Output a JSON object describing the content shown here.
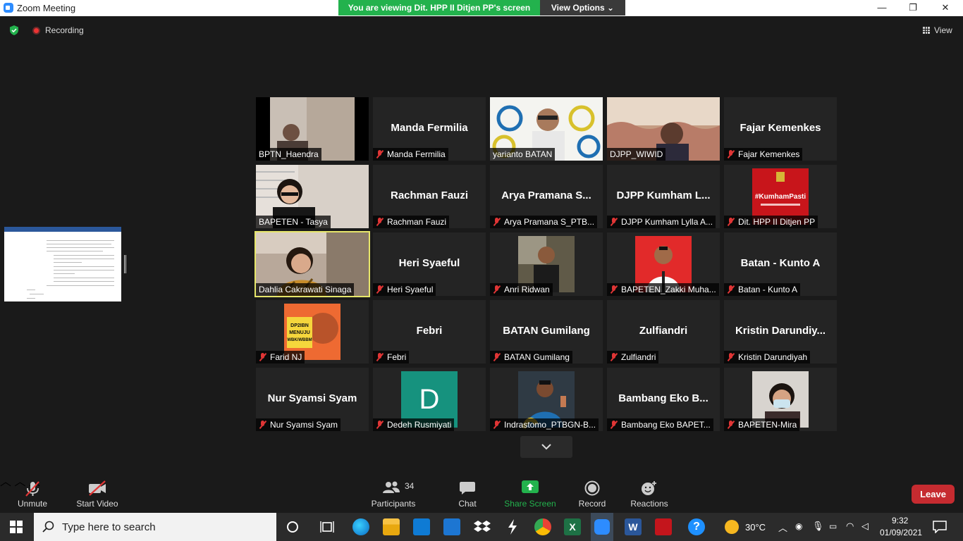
{
  "titlebar": {
    "title": "Zoom Meeting",
    "share_banner": "You are viewing Dit. HPP II Ditjen PP's screen",
    "view_options": "View Options",
    "minimize": "—",
    "maximize": "❐",
    "close": "✕"
  },
  "status": {
    "recording": "Recording",
    "view": "View"
  },
  "participants_grid": [
    {
      "name": "BPTN_Haendra",
      "big": "",
      "muted": false,
      "video": "office"
    },
    {
      "name": "Manda Fermilia",
      "big": "Manda Fermilia",
      "muted": true,
      "video": ""
    },
    {
      "name": "yarianto BATAN",
      "big": "",
      "muted": false,
      "video": "batan"
    },
    {
      "name": "DJPP_WIWID",
      "big": "",
      "muted": false,
      "video": "curtain"
    },
    {
      "name": "Fajar Kemenkes",
      "big": "Fajar Kemenkes",
      "muted": true,
      "video": ""
    },
    {
      "name": "BAPETEN - Tasya",
      "big": "",
      "muted": false,
      "video": "woman"
    },
    {
      "name": "Rachman Fauzi",
      "big": "Rachman Fauzi",
      "muted": true,
      "video": ""
    },
    {
      "name": "Arya Pramana S_PTB...",
      "big": "Arya Pramana S...",
      "muted": true,
      "video": ""
    },
    {
      "name": "DJPP Kumham Lylla A...",
      "big": "DJPP Kumham L...",
      "muted": true,
      "video": ""
    },
    {
      "name": "Dit. HPP II Ditjen PP",
      "big": "",
      "muted": true,
      "video": "kumham"
    },
    {
      "name": "Dahlia Cakrawati Sinaga",
      "big": "",
      "muted": false,
      "video": "dahlia",
      "active": true
    },
    {
      "name": "Heri Syaeful",
      "big": "Heri Syaeful",
      "muted": true,
      "video": ""
    },
    {
      "name": "Anri Ridwan",
      "big": "",
      "muted": true,
      "video": "anri"
    },
    {
      "name": "BAPETEN_Zakki Muha...",
      "big": "",
      "muted": true,
      "video": "zakki"
    },
    {
      "name": "Batan - Kunto A",
      "big": "Batan - Kunto A",
      "muted": true,
      "video": ""
    },
    {
      "name": "Farid NJ",
      "big": "",
      "muted": true,
      "video": "farid"
    },
    {
      "name": "Febri",
      "big": "Febri",
      "muted": true,
      "video": ""
    },
    {
      "name": "BATAN Gumilang",
      "big": "BATAN Gumilang",
      "muted": true,
      "video": ""
    },
    {
      "name": "Zulfiandri",
      "big": "Zulfiandri",
      "muted": true,
      "video": ""
    },
    {
      "name": "Kristin Darundiyah",
      "big": "Kristin  Darundiy...",
      "muted": true,
      "video": ""
    },
    {
      "name": "Nur Syamsi Syam",
      "big": "Nur Syamsi Syam",
      "muted": true,
      "video": ""
    },
    {
      "name": "Dedeh Rusmiyati",
      "big": "",
      "muted": true,
      "video": "avatar-d"
    },
    {
      "name": "Indrastomo_PTBGN-B...",
      "big": "",
      "muted": true,
      "video": "indrastomo"
    },
    {
      "name": "Bambang Eko BAPET...",
      "big": "Bambang Eko B...",
      "muted": true,
      "video": ""
    },
    {
      "name": "BAPETEN-Mira",
      "big": "",
      "muted": true,
      "video": "mira"
    }
  ],
  "farid_poster": "DP2IBN MENUJU WBK/WBBM",
  "kumham_tag": "#KumhamPasti",
  "avatar_letter": "D",
  "toolbar": {
    "unmute": "Unmute",
    "start_video": "Start Video",
    "participants": "Participants",
    "participants_count": "34",
    "chat": "Chat",
    "share_screen": "Share Screen",
    "record": "Record",
    "reactions": "Reactions",
    "leave": "Leave"
  },
  "taskbar": {
    "search_placeholder": "Type here to search",
    "temperature": "30°C",
    "time": "9:32",
    "date": "01/09/2021"
  }
}
